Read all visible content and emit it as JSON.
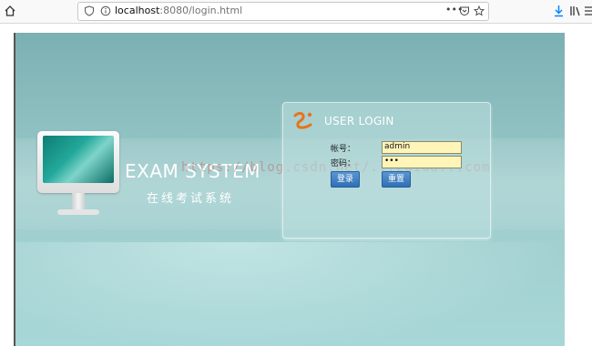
{
  "browser": {
    "url_host": "localhost",
    "url_rest": ":8080/login.html",
    "icons": [
      "home-icon",
      "shield-icon",
      "info-icon",
      "more-icon",
      "pocket-icon",
      "star-icon",
      "download-icon",
      "library-icon",
      "menu-icon"
    ]
  },
  "hero": {
    "title": "EXAM SYSTEM",
    "subtitle": "在线考试系统"
  },
  "login": {
    "title": "USER LOGIN",
    "username_label": "帐号：",
    "password_label": "密码：",
    "username_value": "admin",
    "password_value": "•••",
    "login_button": "登录",
    "reset_button": "重置"
  },
  "watermark": "https://blog.csdn.net/...zuida...com",
  "colors": {
    "background_top": "#7bb0b2",
    "background_bottom": "#a8d7d7",
    "button": "#3a7bbf",
    "input_bg": "#fff5b8",
    "logo_orange": "#e8731c"
  }
}
